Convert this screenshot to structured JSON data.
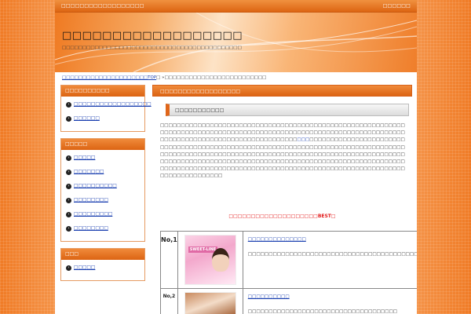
{
  "header": {
    "topbar_left": "□□□□□□□□□□□□□□□□□□",
    "topbar_right": "□□□□□□",
    "site_title": "□□□□□□□□□□□□□□□□□□",
    "site_subtitle": "□□□□□□□□□□□□□□□□□□□□□□□□□□□□□□□□□□□□□□□□□□□□"
  },
  "breadcrumb": {
    "home_link": "□□□□□□□□□□□□□□□□□□□□□TOP",
    "separator": "□ »",
    "current": "□□□□□□□□□□□□□□□□□□□□□□□□□"
  },
  "sidebar": {
    "boxes": [
      {
        "title": "□□□□□□□□□□",
        "items": [
          "□□□□□□□□□□□□□□□□□□",
          "□□□□□□"
        ]
      },
      {
        "title": "□□□□□",
        "items": [
          "□□□□□",
          "□□□□□□□",
          "□□□□□□□□□□",
          "□□□□□□□□",
          "□□□□□□□□□",
          "□□□□□□□□"
        ]
      },
      {
        "title": "□□□",
        "items": [
          "□□□□□"
        ]
      }
    ]
  },
  "main": {
    "title": "□□□□□□□□□□□□□□□□□□",
    "subheading": "□□□□□□□□□□□",
    "paragraph_a": "□□□□□□□□□□□□□□□□□□□□□□□□□□□□□□□□□□□□□□□□□□□□□□□□□□□□□□□□□□□□□□□□□□□□□□□□□□□□□□□□□□□□□□□□□□□□□□□□□□□□□□□□□□□□□□□□□□□□□□□□□□□□□□□□□□□□□□□□□□□□□□□□□□□□□□□",
    "paragraph_link": "□□□",
    "paragraph_b": "□□□□□□□□□□□□□□□□□□□□□□□□□□□□□□□□□□□□□□□□□□□□□□□□□□□□□□□□□□□□□□□□□□□□□□□□□□□□□□□□□□□□□□□□□□□□□□□□□□□□□□□□□□□□□□□□□□□□□□□□□□□□□□□□□□□□□□□□□□□□□□□□□□□□□□□□□□□□□□□□□□□□□□□□□□□□□□□□□□□□□□□□□□□□□□□□□□□□□□□□□□□□□□□□□□□□□□□□□□□□□□□□□□□□□□□□□□□□□□□□□□□□□□□□□□□□□□□□□□□□□□□□□□□□□□□□□□",
    "ranking_title": "□□□□□□□□□□□□□□□□□□□□",
    "ranking_best": "BEST",
    "ranking_suffix": "□",
    "rankings": [
      {
        "rank": "No,1",
        "product_label": "SWEET-LINE",
        "link": "□□□□□□□□□□□□□□",
        "text": "□□□□□□□□□□□□□□□□□□□□□□□□□□□□□□□□□□□□□□□□□□□□□□□□□□□□□□□□□□□□□□□□□□□□□□□□□□□□□□□□□□□□□"
      },
      {
        "rank": "No,2",
        "product_label": "",
        "link": "□□□□□□□□□□",
        "text": "□□□□□□□□□□□□□□□□□□□□□□□□□□□□□□□□□□□□"
      }
    ]
  },
  "colors": {
    "accent": "#e0661a",
    "link": "#1a3fb0",
    "ranking_title": "#e31b1b"
  }
}
